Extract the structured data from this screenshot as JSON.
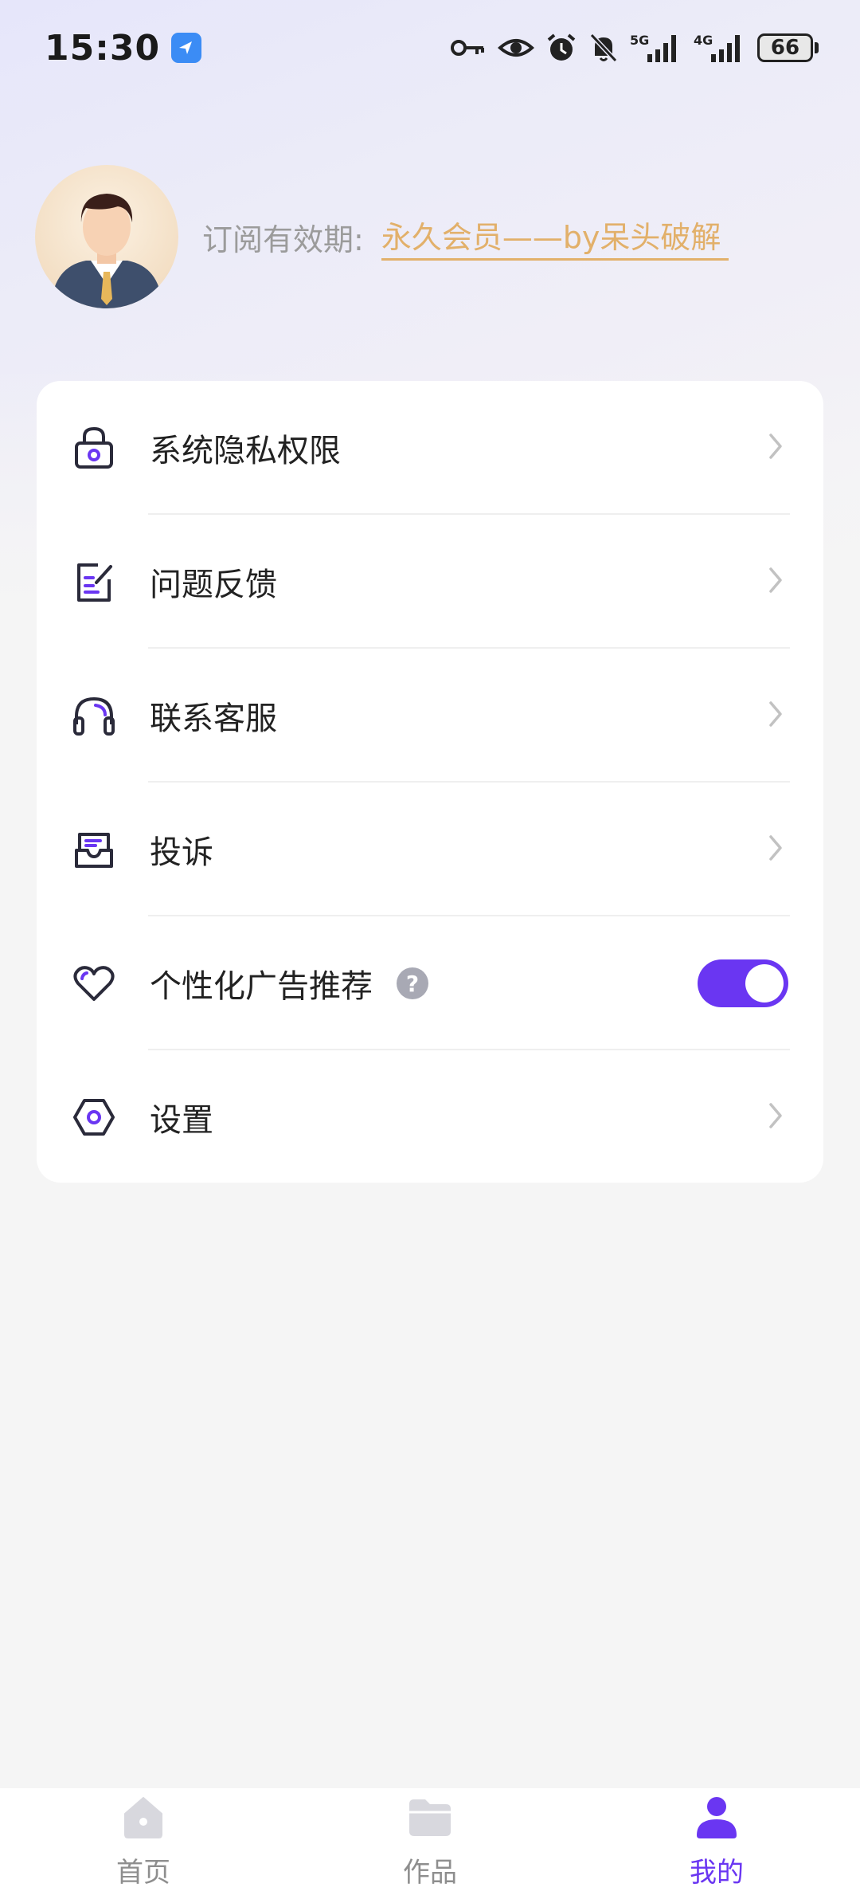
{
  "status_bar": {
    "time": "15:30",
    "network_1": "5G",
    "network_2": "4G",
    "battery": "66",
    "icons": [
      "key-icon",
      "eye-icon",
      "alarm-icon",
      "bell-off-icon",
      "signal-5g-icon",
      "signal-4g-icon",
      "battery-icon"
    ]
  },
  "profile": {
    "subscription_label": "订阅有效期:",
    "subscription_value": "永久会员——by呆头破解"
  },
  "menu": {
    "items": [
      {
        "label": "系统隐私权限",
        "icon": "lock-icon"
      },
      {
        "label": "问题反馈",
        "icon": "feedback-icon"
      },
      {
        "label": "联系客服",
        "icon": "headset-icon"
      },
      {
        "label": "投诉",
        "icon": "complaint-icon"
      },
      {
        "label": "个性化广告推荐",
        "icon": "heart-icon",
        "help": "?",
        "toggle_on": true
      },
      {
        "label": "设置",
        "icon": "settings-icon"
      }
    ]
  },
  "bottom_nav": {
    "items": [
      {
        "label": "首页",
        "icon": "home-icon",
        "active": false
      },
      {
        "label": "作品",
        "icon": "folder-icon",
        "active": false
      },
      {
        "label": "我的",
        "icon": "profile-icon",
        "active": true
      }
    ]
  },
  "colors": {
    "accent": "#6a36f2",
    "gold": "#e2b06a",
    "background": "#f5f5f5"
  }
}
